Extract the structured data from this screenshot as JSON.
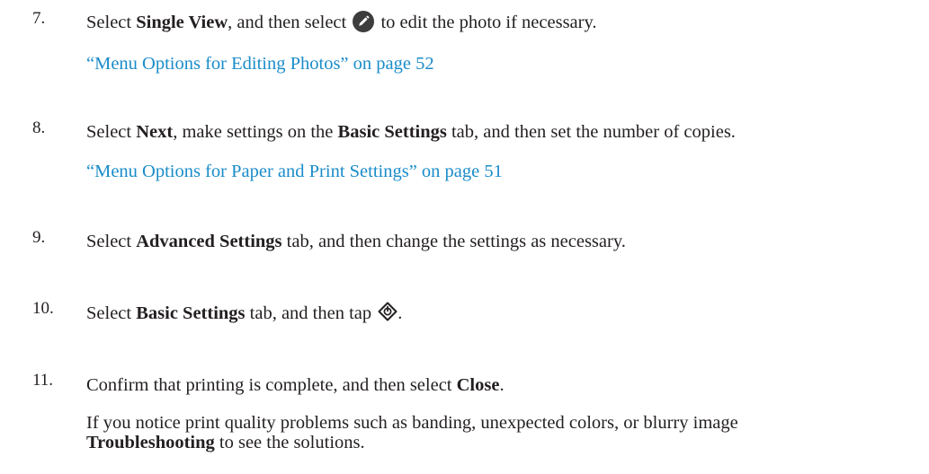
{
  "steps": [
    {
      "number": "7.",
      "parts": [
        "Select ",
        "Single View",
        ", and then select ",
        " to edit the photo if necessary."
      ],
      "icon": "edit-icon",
      "link": "“Menu Options for Editing Photos” on page 52"
    },
    {
      "number": "8.",
      "parts": [
        "Select ",
        "Next",
        ", make settings on the ",
        "Basic Settings",
        " tab, and then set the number of copies."
      ],
      "link": "“Menu Options for Paper and Print Settings” on page 51"
    },
    {
      "number": "9.",
      "parts": [
        "Select ",
        "Advanced Settings",
        " tab, and then change the settings as necessary."
      ]
    },
    {
      "number": "10.",
      "parts": [
        "Select ",
        "Basic Settings",
        " tab, and then tap ",
        "."
      ],
      "icon": "start-diamond-icon"
    },
    {
      "number": "11.",
      "parts": [
        "Confirm that printing is complete, and then select ",
        "Close",
        "."
      ],
      "note_text": "If you notice print quality problems such as banding, unexpected colors, or blurry image",
      "note_bold": "Troubleshooting",
      "note_tail": " to see the solutions."
    }
  ]
}
